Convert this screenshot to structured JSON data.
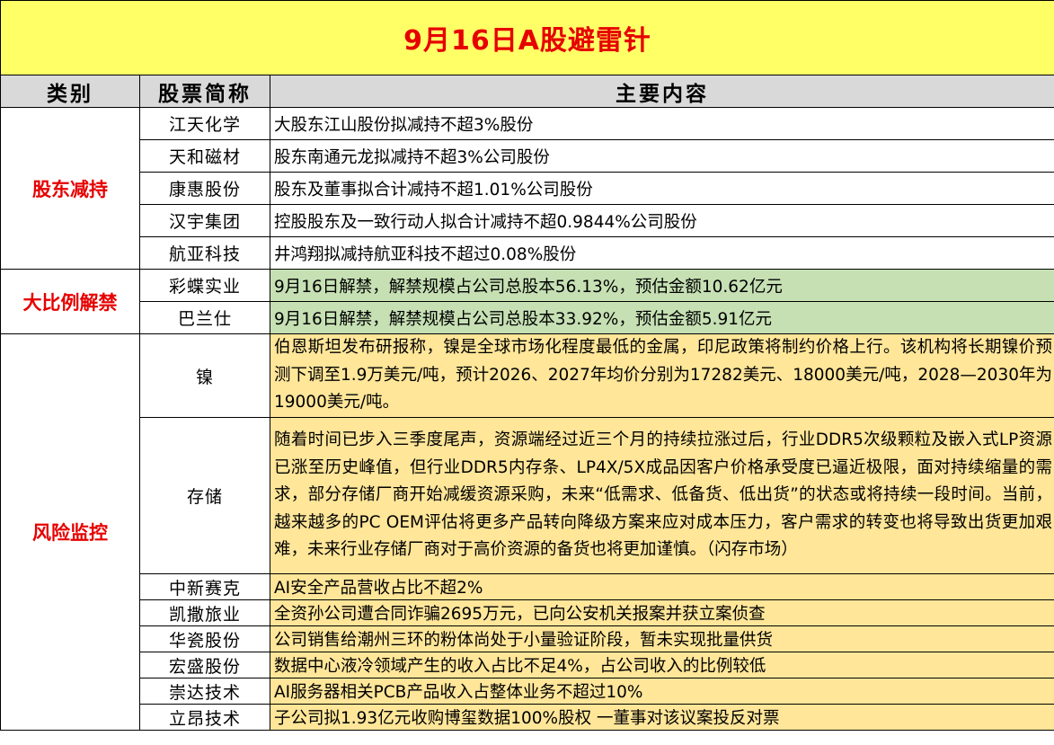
{
  "title": "9月16日A股避雷针",
  "headers": {
    "category": "类别",
    "stock": "股票简称",
    "content": "主要内容"
  },
  "categories": {
    "reduce": "股东减持",
    "unlock": "大比例解禁",
    "risk": "风险监控"
  },
  "reduce_rows": [
    {
      "name": "江天化学",
      "content": "大股东江山股份拟减持不超3%股份"
    },
    {
      "name": "天和磁材",
      "content": "股东南通元龙拟减持不超3%公司股份"
    },
    {
      "name": "康惠股份",
      "content": "股东及董事拟合计减持不超1.01%公司股份"
    },
    {
      "name": "汉宇集团",
      "content": "控股股东及一致行动人拟合计减持不超0.9844%公司股份"
    },
    {
      "name": "航亚科技",
      "content": "井鸿翔拟减持航亚科技不超过0.08%股份"
    }
  ],
  "unlock_rows": [
    {
      "name": "彩蝶实业",
      "content": "9月16日解禁，解禁规模占公司总股本56.13%，预估金额10.62亿元"
    },
    {
      "name": "巴兰仕",
      "content": "9月16日解禁，解禁规模占公司总股本33.92%，预估金额5.91亿元"
    }
  ],
  "risk_rows": [
    {
      "name": "镍",
      "content": "伯恩斯坦发布研报称，镍是全球市场化程度最低的金属，印尼政策将制约价格上行。该机构将长期镍价预测下调至1.9万美元/吨，预计2026、2027年均价分别为17282美元、18000美元/吨，2028—2030年为19000美元/吨。"
    },
    {
      "name": "存储",
      "content": "随着时间已步入三季度尾声，资源端经过近三个月的持续拉涨过后，行业DDR5次级颗粒及嵌入式LP资源已涨至历史峰值，但行业DDR5内存条、LP4X/5X成品因客户价格承受度已逼近极限，面对持续缩量的需求，部分存储厂商开始减缓资源采购，未来“低需求、低备货、低出货”的状态或将持续一段时间。当前，越来越多的PC OEM评估将更多产品转向降级方案来应对成本压力，客户需求的转变也将导致出货更加艰难，未来行业存储厂商对于高价资源的备货也将更加谨慎。（闪存市场）"
    },
    {
      "name": "中新赛克",
      "content": "AI安全产品营收占比不超2%"
    },
    {
      "name": "凯撒旅业",
      "content": "全资孙公司遭合同诈骗2695万元，已向公安机关报案并获立案侦查"
    },
    {
      "name": "华瓷股份",
      "content": "公司销售给潮州三环的粉体尚处于小量验证阶段，暂未实现批量供货"
    },
    {
      "name": "宏盛股份",
      "content": "数据中心液冷领域产生的收入占比不足4%，占公司收入的比例较低"
    },
    {
      "name": "崇达技术",
      "content": "AI服务器相关PCB产品收入占整体业务不超过10%"
    },
    {
      "name": "立昂技术",
      "content": "子公司拟1.93亿元收购博玺数据100%股权 一董事对该议案投反对票"
    }
  ],
  "colors": {
    "title_bg": "#ffff66",
    "title_text": "#e60000",
    "header_bg": "#d9d9d9",
    "unlock_bg": "#c6e0b4",
    "risk_bg": "#ffe699"
  }
}
